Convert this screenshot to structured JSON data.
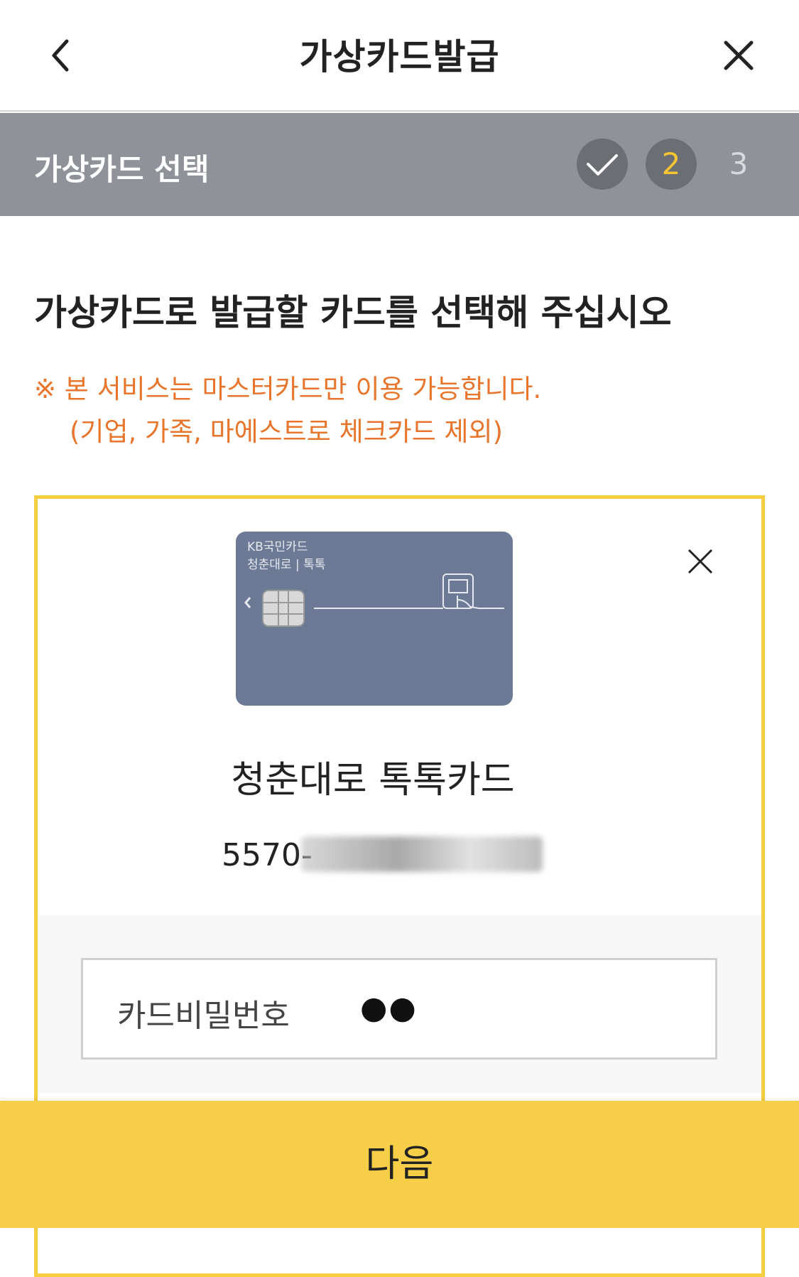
{
  "header": {
    "title": "가상카드발급",
    "back_icon": "chevron-left-icon",
    "close_icon": "close-icon"
  },
  "stepbar": {
    "title": "가상카드 선택",
    "steps": [
      {
        "label": "",
        "state": "done",
        "icon": "check-icon"
      },
      {
        "label": "2",
        "state": "current"
      },
      {
        "label": "3",
        "state": "upcoming"
      }
    ]
  },
  "main": {
    "instruction": "가상카드로 발급할 카드를 선택해 주십시오",
    "notice_line1": "※ 본 서비스는 마스터카드만 이용 가능합니다.",
    "notice_line2": "(기업, 가족, 마에스트로 체크카드 제외)"
  },
  "card": {
    "brand": "KB국민카드",
    "brand_sub": "청춘대로 | 톡톡",
    "name": "청춘대로 톡톡카드",
    "number_prefix": "5570-",
    "remove_icon": "close-icon",
    "color": "#6c7a95"
  },
  "password": {
    "label": "카드비밀번호",
    "value": "●●"
  },
  "footer": {
    "next_label": "다음"
  },
  "colors": {
    "accent": "#f7ce48",
    "border_highlight": "#f5ce42",
    "notice": "#e8752c",
    "stepbar": "#8f9399"
  }
}
